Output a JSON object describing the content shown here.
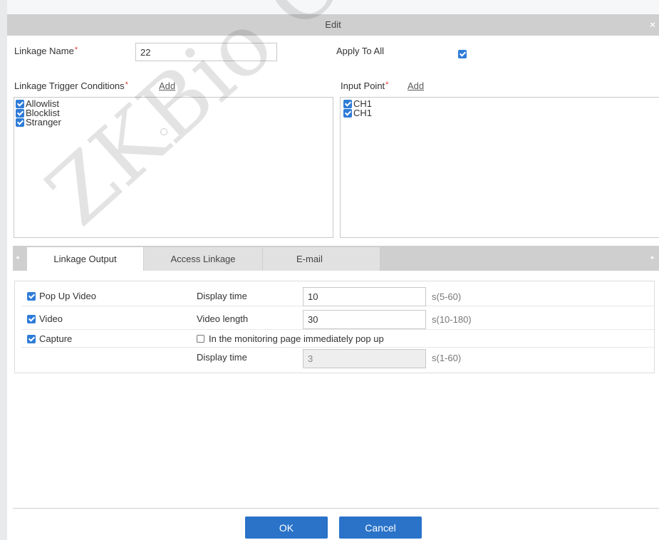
{
  "dialog": {
    "title": "Edit"
  },
  "form": {
    "linkage_name_label": "Linkage Name",
    "linkage_name_value": "22",
    "apply_to_all_label": "Apply To All",
    "apply_to_all_checked": true,
    "required_mark": "*",
    "trigger_label": "Linkage Trigger Conditions",
    "trigger_add": "Add",
    "trigger_items": [
      {
        "label": "Allowlist",
        "checked": true
      },
      {
        "label": "Blocklist",
        "checked": true
      },
      {
        "label": "Stranger",
        "checked": true
      }
    ],
    "input_point_label": "Input Point",
    "input_point_add": "Add",
    "input_point_items": [
      {
        "label": "CH1",
        "checked": true
      },
      {
        "label": "CH1",
        "checked": true
      }
    ]
  },
  "tabs": [
    {
      "label": "Linkage Output",
      "active": true
    },
    {
      "label": "Access Linkage",
      "active": false
    },
    {
      "label": "E-mail",
      "active": false
    }
  ],
  "output": {
    "pop_up_video": "Pop Up Video",
    "video": "Video",
    "capture": "Capture",
    "display_time_label": "Display time",
    "display_time_value": "10",
    "display_time_range": "s(5-60)",
    "video_length_label": "Video length",
    "video_length_value": "30",
    "video_length_range": "s(10-180)",
    "monitoring_popup_label": "In the monitoring page immediately pop up",
    "monitoring_popup_checked": false,
    "capture_display_time_label": "Display time",
    "capture_display_time_value": "3",
    "capture_display_time_range": "s(1-60)"
  },
  "buttons": {
    "ok": "OK",
    "cancel": "Cancel"
  },
  "watermark": "ZKBio CV"
}
